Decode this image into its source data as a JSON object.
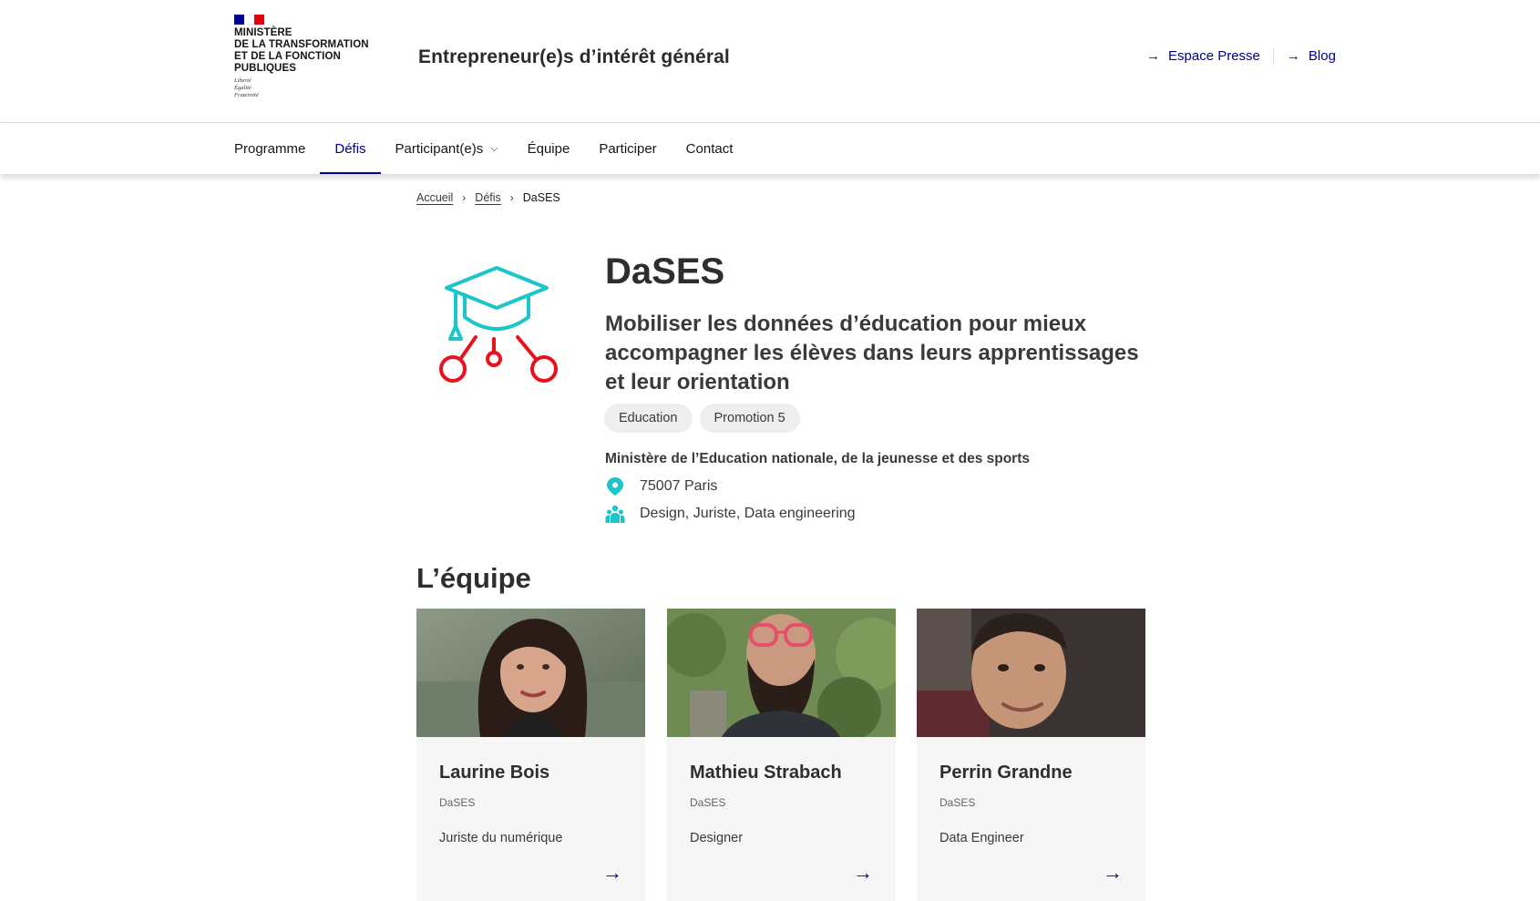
{
  "header": {
    "ministry_lines": [
      "Ministère",
      "de la transformation",
      "et de la fonction",
      "publiques"
    ],
    "devise_lines": [
      "Liberté",
      "Égalité",
      "Fraternité"
    ],
    "site_title": "Entrepreneur(e)s d’intérêt général",
    "tools": [
      {
        "label": "Espace Presse",
        "icon": "arrow-right-icon"
      },
      {
        "label": "Blog",
        "icon": "arrow-right-icon"
      }
    ]
  },
  "nav": {
    "items": [
      {
        "label": "Programme",
        "active": false
      },
      {
        "label": "Défis",
        "active": true
      },
      {
        "label": "Participant(e)s",
        "active": false,
        "dropdown": true
      },
      {
        "label": "Équipe",
        "active": false
      },
      {
        "label": "Participer",
        "active": false
      },
      {
        "label": "Contact",
        "active": false
      }
    ]
  },
  "breadcrumb": {
    "items": [
      "Accueil",
      "Défis"
    ],
    "current": "DaSES"
  },
  "project": {
    "title": "DaSES",
    "subtitle": "Mobiliser les données d’éducation pour mieux accompagner les élèves dans leurs apprentissages et leur orientation",
    "tags": [
      "Education",
      "Promotion 5"
    ],
    "organization": "Ministère de l’Education nationale, de la jeunesse et des sports",
    "location": "75007 Paris",
    "skills": "Design, Juriste, Data engineering",
    "icon": "graduation-cap-network-icon",
    "colors": {
      "teal": "#1bc5c9",
      "red": "#e8121d"
    }
  },
  "team": {
    "title": "L’équipe",
    "members": [
      {
        "name": "Laurine Bois",
        "team": "DaSES",
        "role": "Juriste du numérique"
      },
      {
        "name": "Mathieu Strabach",
        "team": "DaSES",
        "role": "Designer"
      },
      {
        "name": "Perrin Grandne",
        "team": "DaSES",
        "role": "Data Engineer"
      }
    ]
  },
  "colors": {
    "accent": "#000091",
    "text": "#3a3a3a",
    "card_bg": "#f6f6f6",
    "tag_bg": "#eeeeee"
  }
}
